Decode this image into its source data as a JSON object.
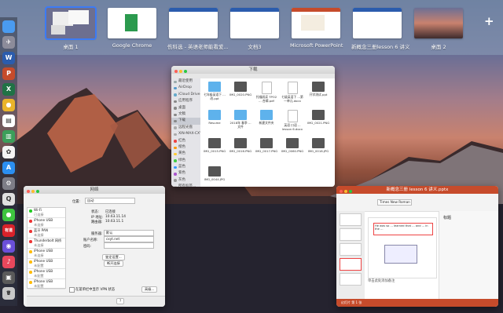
{
  "spaces": [
    {
      "label": "桌面 1",
      "active": true
    },
    {
      "label": "Google Chrome"
    },
    {
      "label": "伤科选 - 英语老师能看爱..."
    },
    {
      "label": "文档3"
    },
    {
      "label": "Microsoft PowerPoint"
    },
    {
      "label": "新概念三册lesson 6 讲义"
    },
    {
      "label": "桌面 2"
    }
  ],
  "add_space": "+",
  "dock": [
    {
      "icon": "finder-icon",
      "color": "#4a9bf0",
      "glyph": ""
    },
    {
      "icon": "rocket-icon",
      "color": "#8c8c9a",
      "glyph": "✈"
    },
    {
      "icon": "word-icon",
      "color": "#2b5cad",
      "glyph": "W"
    },
    {
      "icon": "powerpoint-icon",
      "color": "#c64b2b",
      "glyph": "P"
    },
    {
      "icon": "excel-icon",
      "color": "#207245",
      "glyph": "X"
    },
    {
      "icon": "chrome-icon",
      "color": "#e9b42a",
      "glyph": "●"
    },
    {
      "icon": "calendar-icon",
      "color": "#ffffff",
      "glyph": "▤"
    },
    {
      "icon": "stats-icon",
      "color": "#3c9f5a",
      "glyph": "▥"
    },
    {
      "icon": "photos-icon",
      "color": "#f4f4f4",
      "glyph": "✿"
    },
    {
      "icon": "appstore-icon",
      "color": "#2b8ff0",
      "glyph": "A"
    },
    {
      "icon": "preferences-icon",
      "color": "#7d7d86",
      "glyph": "⚙"
    },
    {
      "icon": "qq-icon",
      "color": "#e0e0e0",
      "glyph": "Q"
    },
    {
      "icon": "wechat-icon",
      "color": "#3ec43f",
      "glyph": "●"
    },
    {
      "icon": "youdao-icon",
      "color": "#d8222a",
      "glyph": "有道"
    },
    {
      "icon": "siri-icon",
      "color": "#6a4fd8",
      "glyph": "◉"
    },
    {
      "icon": "music-icon",
      "color": "#e8485c",
      "glyph": "♪"
    },
    {
      "icon": "app-icon",
      "color": "#5a5a5a",
      "glyph": "▣"
    },
    {
      "icon": "trash-icon",
      "color": "#c8c8c8",
      "glyph": "🗑"
    }
  ],
  "finder": {
    "title": "下载",
    "sidebar": [
      {
        "label": "最近使用",
        "color": "#9aa"
      },
      {
        "label": "AirDrop",
        "color": "#59c"
      },
      {
        "label": "iCloud Drive",
        "color": "#6ac"
      },
      {
        "label": "应用程序",
        "color": "#888"
      },
      {
        "label": "桌面",
        "color": "#888"
      },
      {
        "label": "文稿",
        "color": "#888"
      },
      {
        "label": "下载",
        "color": "#888",
        "selected": true
      },
      {
        "label": "远程光盘",
        "color": "#aaa"
      },
      {
        "label": "XIN-MAX-CXY",
        "color": "#aaa"
      },
      {
        "label": "红色",
        "color": "#e44"
      },
      {
        "label": "橙色",
        "color": "#f90"
      },
      {
        "label": "黄色",
        "color": "#fc3"
      },
      {
        "label": "绿色",
        "color": "#4c4"
      },
      {
        "label": "蓝色",
        "color": "#39f"
      },
      {
        "label": "紫色",
        "color": "#a5c"
      },
      {
        "label": "灰色",
        "color": "#999"
      },
      {
        "label": "所有标签...",
        "color": "#ccc"
      }
    ],
    "files": [
      {
        "name": "七年级英语下 ...改.ppt",
        "type": "folder"
      },
      {
        "name": "IMG_0020.PNG",
        "type": "img"
      },
      {
        "name": "托福阅读 TPO2 ... 合辑.pdf",
        "type": "doc"
      },
      {
        "name": "七级英语下 ...第一单元.docx",
        "type": "doc"
      },
      {
        "name": "开学测试.ppt",
        "type": "img"
      },
      {
        "name": "Resume",
        "type": "folder"
      },
      {
        "name": "2018年 春季 ...文件",
        "type": "folder"
      },
      {
        "name": "新建文件夹",
        "type": "folder"
      },
      {
        "name": "英语 口语 ... lesson 6.docx",
        "type": "doc"
      },
      {
        "name": "IMG_0021.PNG",
        "type": "img"
      },
      {
        "name": "IMG_0015.PNG",
        "type": "img"
      },
      {
        "name": "IMG_0016.PNG",
        "type": "img"
      },
      {
        "name": "IMG_0017.PNG",
        "type": "img"
      },
      {
        "name": "IMG_0060.PNG",
        "type": "img"
      },
      {
        "name": "IMG_0018.JPG",
        "type": "img"
      },
      {
        "name": "IMG_0044.JPG",
        "type": "img"
      }
    ]
  },
  "network": {
    "title": "网络",
    "location_label": "位置:",
    "location_value": "自动",
    "interfaces": [
      {
        "name": "Wi-Fi",
        "status": "已连接",
        "color": "#2c2"
      },
      {
        "name": "iPhone USB",
        "status": "未连接",
        "color": "#e33"
      },
      {
        "name": "蓝牙 PAN",
        "status": "未连接",
        "color": "#e33"
      },
      {
        "name": "Thunderbolt 网桥",
        "status": "未连接",
        "color": "#e33"
      },
      {
        "name": "iPhone USB",
        "status": "未连接",
        "color": "#fb0"
      },
      {
        "name": "iPhone USB",
        "status": "未配置",
        "color": "#fb0"
      },
      {
        "name": "iPhone USB",
        "status": "未配置",
        "color": "#fb0"
      },
      {
        "name": "iPhone USB",
        "status": "未配置",
        "color": "#fb0"
      }
    ],
    "status_label": "状态:",
    "status_value": "已连接",
    "ip_label": "IP 地址:",
    "ip_value": "10.63.11.14",
    "router_label": "路由器:",
    "router_value": "10.63.11.1",
    "server_label": "服务器:",
    "server_value": "默认",
    "account_label": "账户名称:",
    "account_value": "cxyt.net",
    "password_label": "密码:",
    "password_value": "",
    "btn_auth": "鉴定设置...",
    "btn_disconnect": "断开连接",
    "checkbox_label": "在菜单栏中显示 VPN 状态",
    "btn_advanced": "高级...",
    "btn_help": "?"
  },
  "ppt": {
    "title": "新概念三册 lesson 6 讲义.pptx",
    "menu_font": "Times New Roman",
    "slide_header": "标题",
    "slide_text": "He was so ... learned that ... and ... in the ...",
    "notes_text": "单击此处添加备注",
    "status": "幻灯片 第 1 张"
  }
}
